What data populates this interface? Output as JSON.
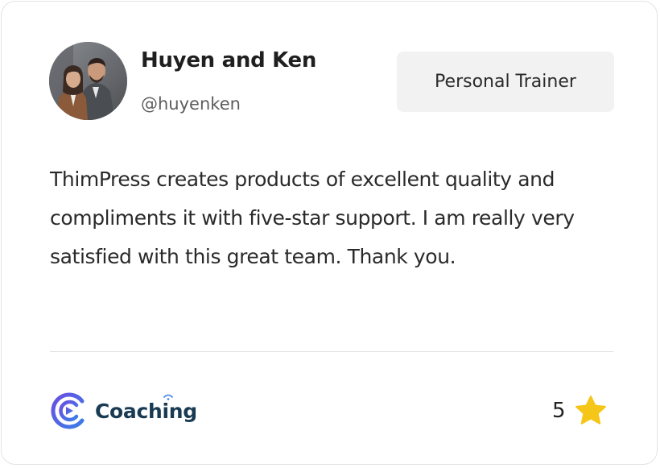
{
  "author": {
    "name": "Huyen and Ken",
    "handle": "@huyenken",
    "avatar_icon": "couple-photo-avatar"
  },
  "tag": {
    "label": "Personal Trainer"
  },
  "testimonial": {
    "text": "ThimPress creates products of excellent quality and compliments it with five-star support. I am really very satisfied with this great team. Thank you."
  },
  "brand": {
    "name": "Coaching",
    "logo_icon": "coaching-c-logo-icon",
    "colors": {
      "logo_gradient_start": "#6b4fe0",
      "logo_gradient_end": "#3a7ee8",
      "text": "#183a52"
    }
  },
  "rating": {
    "value": "5",
    "icon": "star-icon",
    "star_color": "#f5c518"
  },
  "colors": {
    "card_border": "#e3e3e3",
    "pill_background": "#f2f2f2",
    "divider": "#e2e2e2"
  }
}
